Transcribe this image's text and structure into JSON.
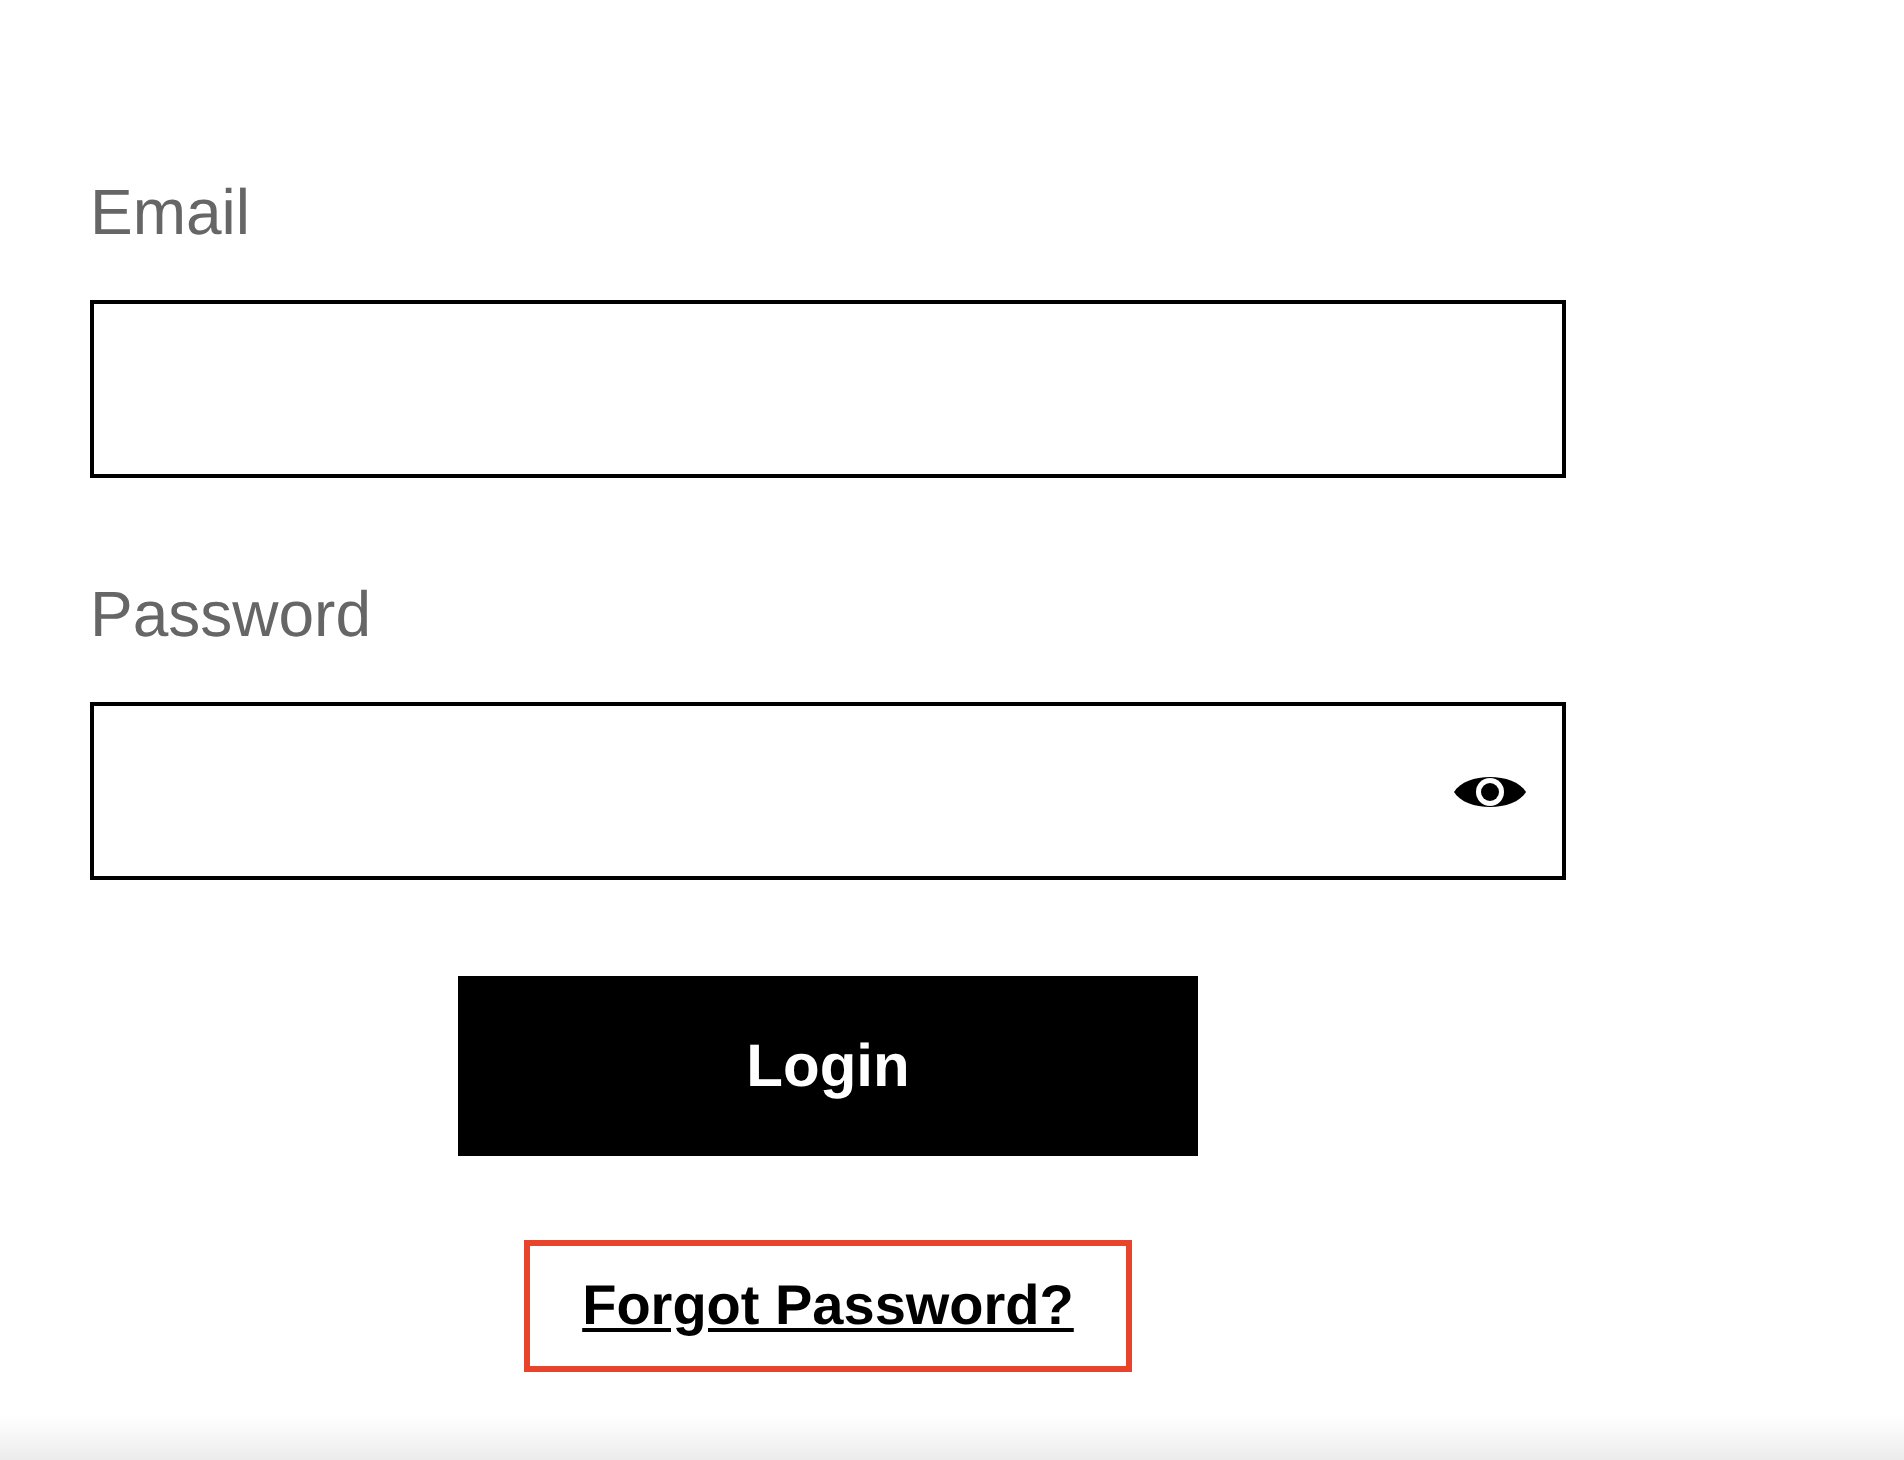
{
  "fields": [
    {
      "label": "Email",
      "kind": "text"
    },
    {
      "label": "Password",
      "kind": "password"
    }
  ],
  "login_button": "Login",
  "forgot_link": {
    "label": "Forgot Password?",
    "highlighted": true
  }
}
